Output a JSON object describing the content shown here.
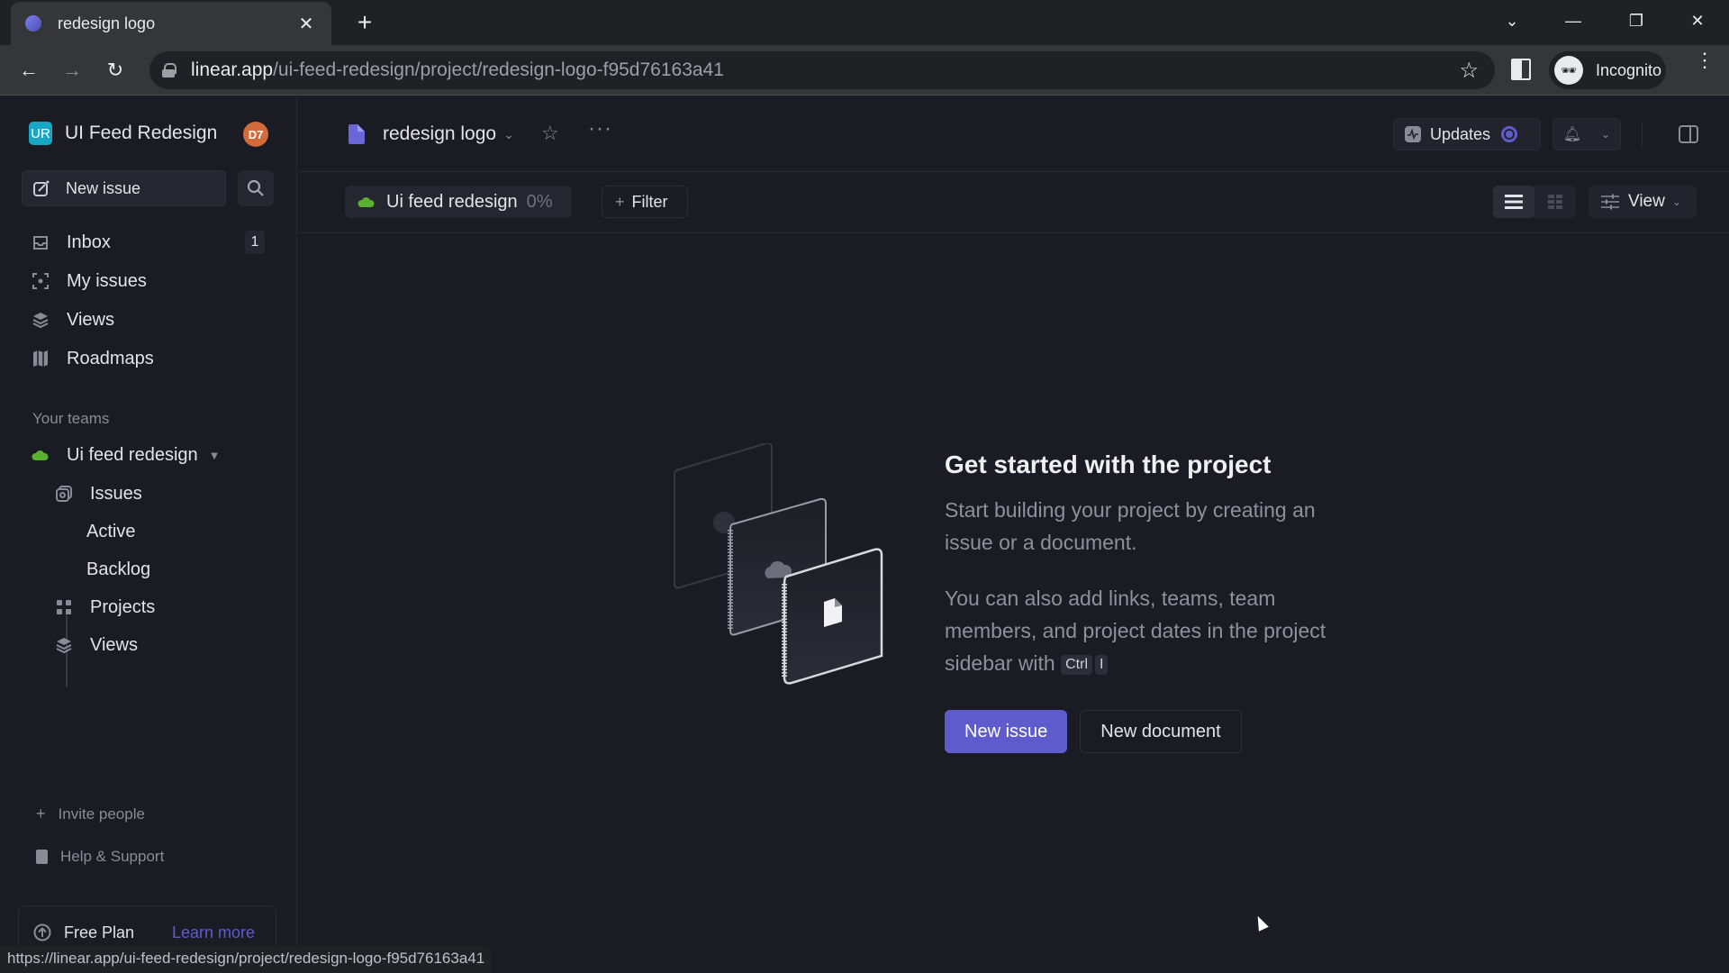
{
  "browser": {
    "tab_title": "redesign logo",
    "url_host": "linear.app",
    "url_path": "/ui-feed-redesign/project/redesign-logo-f95d76163a41",
    "profile_label": "Incognito",
    "status_url": "https://linear.app/ui-feed-redesign/project/redesign-logo-f95d76163a41"
  },
  "sidebar": {
    "workspace_initials": "UR",
    "workspace_name": "UI Feed Redesign",
    "user_avatar": "D7",
    "new_issue_label": "New issue",
    "nav": [
      {
        "label": "Inbox",
        "icon": "inbox-icon",
        "badge": "1"
      },
      {
        "label": "My issues",
        "icon": "my-issues-icon"
      },
      {
        "label": "Views",
        "icon": "layers-icon"
      },
      {
        "label": "Roadmaps",
        "icon": "map-icon"
      }
    ],
    "teams_heading": "Your teams",
    "team": {
      "name": "Ui feed redesign",
      "items": [
        {
          "label": "Issues",
          "icon": "issues-icon"
        },
        {
          "label": "Active"
        },
        {
          "label": "Backlog"
        },
        {
          "label": "Projects",
          "icon": "grid-icon"
        },
        {
          "label": "Views",
          "icon": "layers-icon"
        }
      ]
    },
    "invite_label": "Invite people",
    "help_label": "Help & Support",
    "plan_label": "Free Plan",
    "learn_more_label": "Learn more"
  },
  "header": {
    "project_name": "redesign logo",
    "updates_label": "Updates",
    "team_chip_label": "Ui feed redesign",
    "team_chip_progress": "0%",
    "filter_label": "Filter",
    "view_label": "View"
  },
  "empty_state": {
    "title": "Get started with the project",
    "description": "Start building your project by creating an issue or a document.",
    "hint_prefix": "You can also add links, teams, team members, and project dates in the project sidebar with",
    "shortcut_keys": [
      "Ctrl",
      "I"
    ],
    "primary_button": "New issue",
    "secondary_button": "New document"
  },
  "colors": {
    "accent": "#5e5ccc",
    "team_green": "#5ab031",
    "workspace_logo": "#17a7c4",
    "avatar": "#d4693a"
  }
}
